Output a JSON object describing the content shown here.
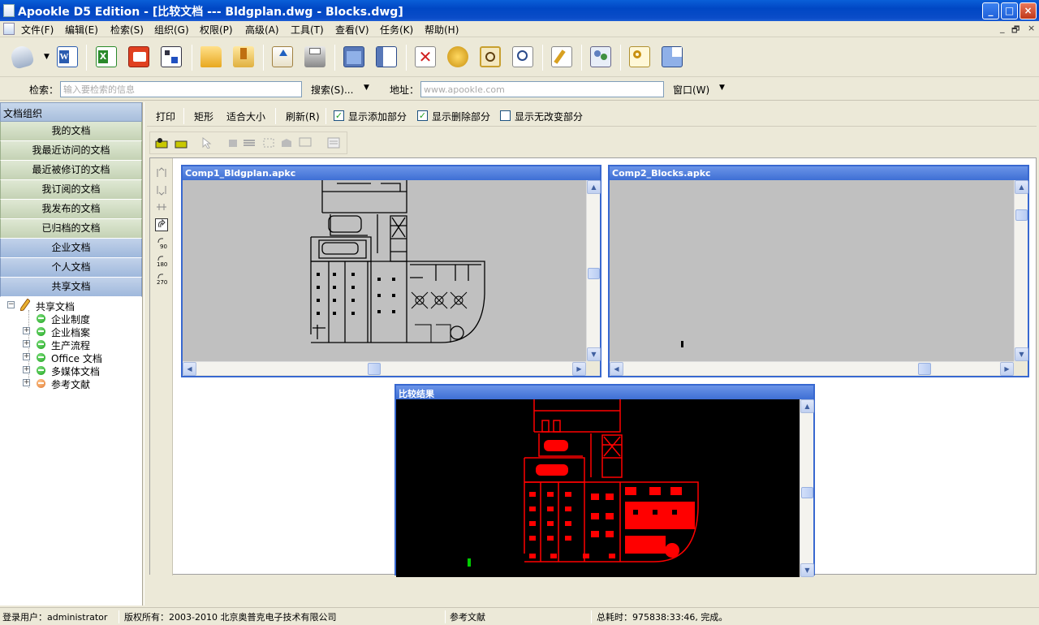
{
  "window": {
    "title": "Apookle D5 Edition - [比较文档 --- Bldgplan.dwg - Blocks.dwg]",
    "controls": {
      "minimize": "_",
      "maximize": "□",
      "close": "×"
    }
  },
  "menu": {
    "items": [
      "文件(F)",
      "编辑(E)",
      "检索(S)",
      "组织(G)",
      "权限(P)",
      "高级(A)",
      "工具(T)",
      "查看(V)",
      "任务(K)",
      "帮助(H)"
    ],
    "mdi_controls": [
      "_",
      "🗗",
      "×"
    ]
  },
  "toolbar": {
    "icons": [
      "scanner-icon",
      "word-icon",
      "excel-icon",
      "email-icon",
      "batch-icon",
      "open-folder-icon",
      "import-icon",
      "upload-icon",
      "print-icon",
      "window-icon",
      "split-window-icon",
      "delete-icon",
      "refresh-icon",
      "preview-icon",
      "zoom-icon",
      "edit-icon",
      "users-icon",
      "key-icon",
      "layout-icon"
    ]
  },
  "search": {
    "label": "检索：",
    "placeholder": "输入要检索的信息",
    "search_button": "搜索(S)...",
    "address_label": "地址：",
    "address_placeholder": "www.apookle.com",
    "window_menu": "窗口(W)"
  },
  "left_panel": {
    "header": "文档组织",
    "green_items": [
      "我的文档",
      "我最近访问的文档",
      "最近被修订的文档",
      "我订阅的文档",
      "我发布的文档",
      "已归档的文档"
    ],
    "blue_items": [
      "企业文档",
      "个人文档",
      "共享文档"
    ],
    "tree": {
      "root": "共享文档",
      "children": [
        {
          "label": "企业制度",
          "status": "green"
        },
        {
          "label": "企业档案",
          "status": "green"
        },
        {
          "label": "生产流程",
          "status": "green"
        },
        {
          "label": "Office 文档",
          "status": "green"
        },
        {
          "label": "多媒体文档",
          "status": "green"
        },
        {
          "label": "参考文献",
          "status": "orange"
        }
      ]
    }
  },
  "compare_bar": {
    "print": "打印",
    "rect": "矩形",
    "fit": "适合大小",
    "refresh": "刷新(R)",
    "show_added": "显示添加部分",
    "show_deleted": "显示删除部分",
    "show_unchanged": "显示无改变部分",
    "show_added_checked": true,
    "show_deleted_checked": true,
    "show_unchanged_checked": false
  },
  "side_tools": {
    "rotate_labels": [
      "90",
      "180",
      "270"
    ]
  },
  "docs": {
    "left_title": "Comp1_Bldgplan.apkc",
    "right_title": "Comp2_Blocks.apkc",
    "result_title": "比较结果"
  },
  "colors": {
    "title_bar": "#0a4cc8",
    "doc_bg": "#c0c0c0",
    "drawing_line": "#000000",
    "result_bg": "#000000",
    "result_line": "#ff0000",
    "result_added": "#00cc00"
  },
  "status": {
    "user": "登录用户：administrator",
    "copyright": "版权所有：2003-2010 北京奥普克电子技术有限公司",
    "current": "参考文献",
    "elapsed": "总耗时：975838:33:46, 完成。"
  }
}
